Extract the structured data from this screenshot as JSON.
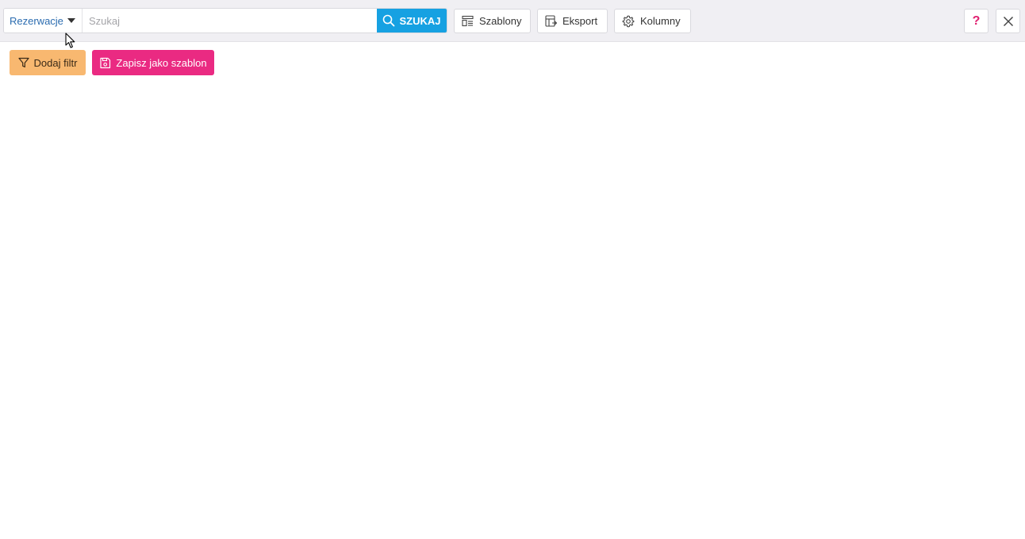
{
  "search": {
    "scope_label": "Rezerwacje",
    "placeholder": "Szukaj",
    "value": "",
    "button_label": "SZUKAJ"
  },
  "toolbar": {
    "templates_label": "Szablony",
    "export_label": "Eksport",
    "columns_label": "Kolumny",
    "help_label": "?"
  },
  "filters": {
    "add_filter_label": "Dodaj filtr",
    "save_template_label": "Zapisz jako szablon"
  },
  "colors": {
    "search_button": "#16a1e2",
    "add_filter": "#f8b870",
    "save_template": "#ea2a82",
    "help_accent": "#e01f6f",
    "scope_text": "#2b6cb0"
  }
}
